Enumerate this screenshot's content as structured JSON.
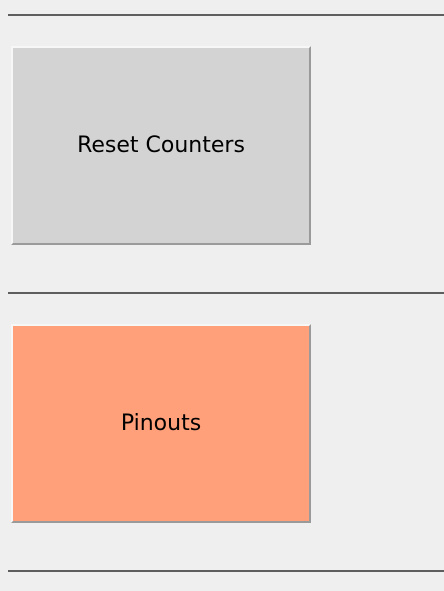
{
  "buttons": {
    "reset_counters": {
      "label": "Reset Counters",
      "color": "#d3d3d3"
    },
    "pinouts": {
      "label": "Pinouts",
      "color": "#ffa07a"
    }
  },
  "colors": {
    "background": "#efefef",
    "divider": "#5e5e5e"
  }
}
